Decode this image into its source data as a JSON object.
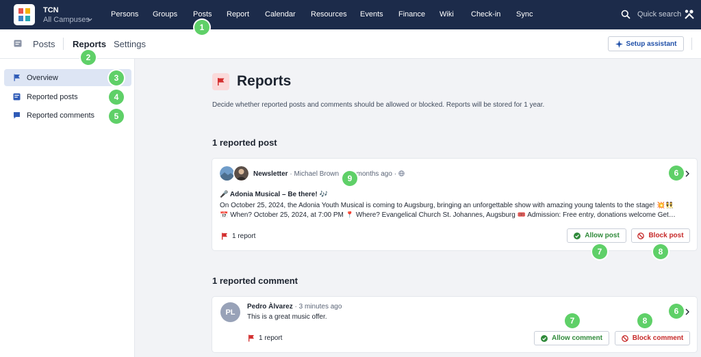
{
  "topnav": {
    "org_name": "TCN",
    "org_sub": "All Campuses",
    "items": [
      "Persons",
      "Groups",
      "Posts",
      "Report",
      "Calendar",
      "Resources",
      "Events",
      "Finance",
      "Wiki",
      "Check-in",
      "Sync"
    ],
    "search_placeholder": "Quick search"
  },
  "subheader": {
    "tabs": [
      "Posts",
      "Reports",
      "Settings"
    ],
    "active_tab": "Reports",
    "setup_label": "Setup assistant"
  },
  "sidebar": {
    "items": [
      {
        "label": "Overview",
        "icon": "flag-icon",
        "active": true
      },
      {
        "label": "Reported posts",
        "icon": "posts-icon",
        "active": false
      },
      {
        "label": "Reported comments",
        "icon": "comment-icon",
        "active": false
      }
    ]
  },
  "main": {
    "title": "Reports",
    "description": "Decide whether reported posts and comments should be allowed or blocked. Reports will be stored for 1 year.",
    "posts_section_title": "1 reported post",
    "comments_section_title": "1 reported comment"
  },
  "post_card": {
    "group": "Newsletter",
    "separator": "·",
    "author": "Michael Brown",
    "time": "months ago",
    "title": "🎤 Adonia Musical – Be there! 🎶",
    "line1": "On October 25, 2024, the Adonia Youth Musical is coming to Augsburg, bringing an unforgettable show with amazing young talents to the stage! 💥👯",
    "line2": "📅 When? October 25, 2024, at 7:00 PM 📍 Where? Evangelical Church St. Johannes, Augsburg 🎟️ Admission: Free entry, donations welcome Get…",
    "report_count": "1 report",
    "allow_label": "Allow post",
    "block_label": "Block post"
  },
  "comment_card": {
    "avatar_initials": "PL",
    "author": "Pedro Àlvarez",
    "separator": "·",
    "time": "3 minutes ago",
    "text": "This is a great music offer.",
    "report_count": "1 report",
    "allow_label": "Allow comment",
    "block_label": "Block comment"
  },
  "markers": [
    "1",
    "2",
    "3",
    "4",
    "5",
    "6",
    "7",
    "8",
    "9",
    "6",
    "7",
    "8"
  ],
  "colors": {
    "nav_bg": "#1c2b4a",
    "accent_blue": "#1f4fa8",
    "allow_green": "#2f8a3a",
    "block_red": "#c62828",
    "marker_green": "#5fd068",
    "sidebar_active": "#dde5f4"
  }
}
